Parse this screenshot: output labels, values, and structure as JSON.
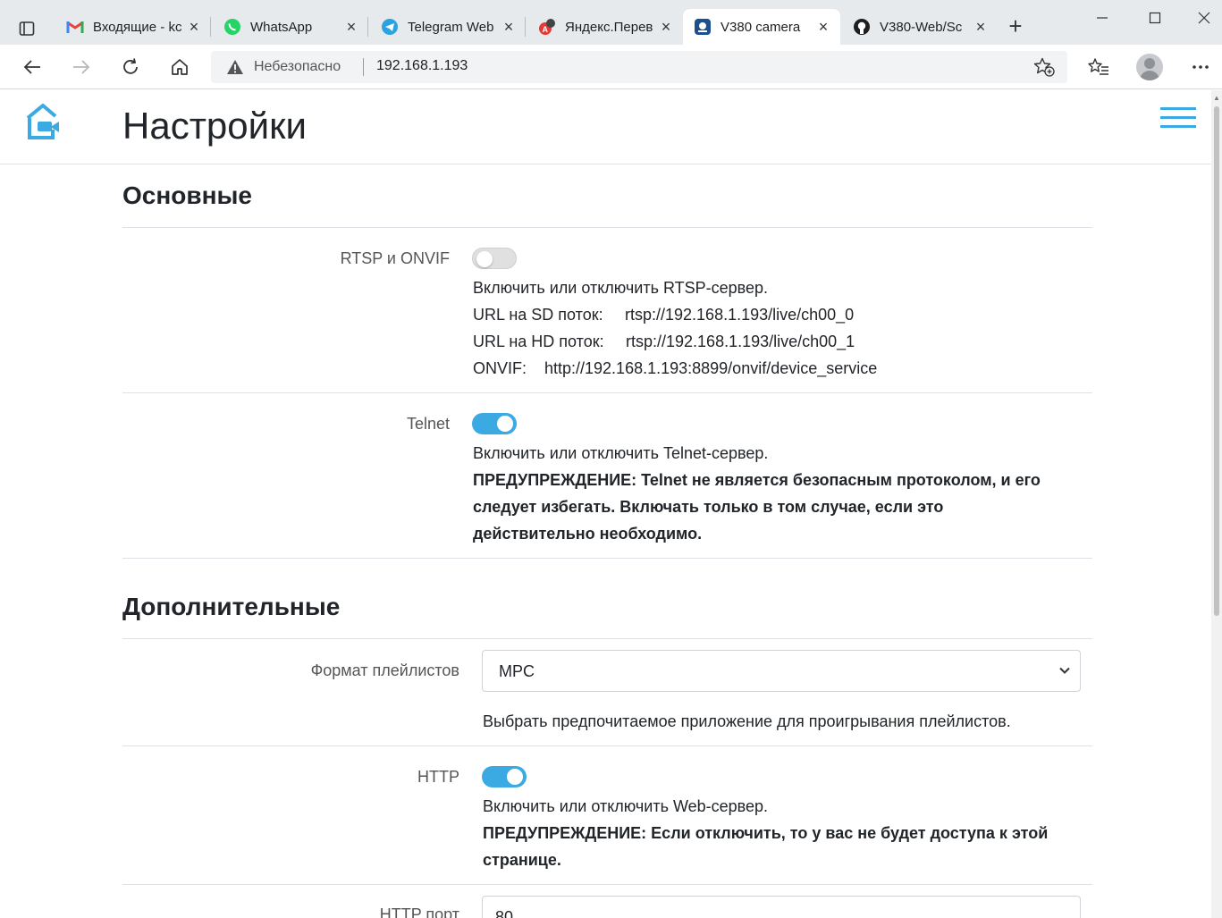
{
  "browser": {
    "tabs": [
      {
        "title": "Входящие - kc",
        "icon": "gmail-icon"
      },
      {
        "title": "WhatsApp",
        "icon": "whatsapp-icon"
      },
      {
        "title": "Telegram Web",
        "icon": "telegram-icon"
      },
      {
        "title": "Яндекс.Перев",
        "icon": "yandex-translate-icon"
      },
      {
        "title": "V380 camera",
        "icon": "v380-icon",
        "active": true
      },
      {
        "title": "V380-Web/Sc",
        "icon": "github-icon"
      }
    ],
    "address": {
      "security_text": "Небезопасно",
      "url": "192.168.1.193"
    }
  },
  "header": {
    "title": "Настройки"
  },
  "sections": {
    "basic": {
      "title": "Основные",
      "rtsp": {
        "label": "RTSP и ONVIF",
        "enabled": false,
        "description": "Включить или отключить RTSP-сервер.",
        "sd_label": "URL на SD поток:",
        "sd_url": "rtsp://192.168.1.193/live/ch00_0",
        "hd_label": "URL на HD поток:",
        "hd_url": "rtsp://192.168.1.193/live/ch00_1",
        "onvif_label": "ONVIF:",
        "onvif_url": "http://192.168.1.193:8899/onvif/device_service"
      },
      "telnet": {
        "label": "Telnet",
        "enabled": true,
        "description": "Включить или отключить Telnet-сервер.",
        "warning_line1": "ПРЕДУПРЕЖДЕНИЕ: Telnet не является безопасным протоколом, и его",
        "warning_line2": "следует избегать. Включать только в том случае, если это",
        "warning_line3": "действительно необходимо."
      }
    },
    "advanced": {
      "title": "Дополнительные",
      "playlist": {
        "label": "Формат плейлистов",
        "value": "MPC",
        "description": "Выбрать предпочитаемое приложение для проигрывания плейлистов."
      },
      "http": {
        "label": "HTTP",
        "enabled": true,
        "description": "Включить или отключить Web-сервер.",
        "warning_line1": "ПРЕДУПРЕЖДЕНИЕ: Если отключить, то у вас не будет доступа к этой",
        "warning_line2": "странице."
      },
      "http_port": {
        "label": "HTTP порт",
        "value": "80"
      }
    }
  },
  "colors": {
    "accent": "#3ba9e2"
  }
}
